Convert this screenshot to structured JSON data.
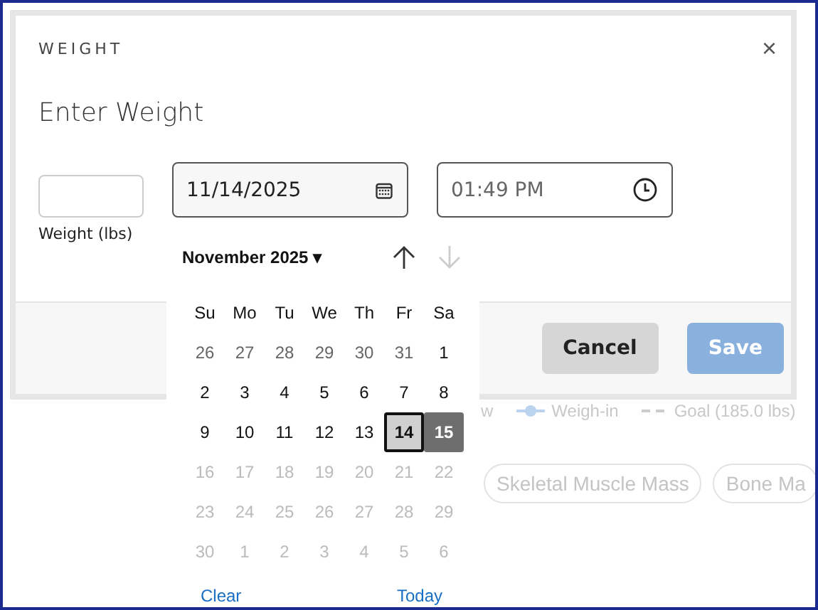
{
  "background": {
    "legend": [
      {
        "kind": "text",
        "label": "w"
      },
      {
        "kind": "line-dot",
        "label": "Weigh-in"
      },
      {
        "kind": "dashed",
        "label": "Goal (185.0 lbs)"
      }
    ],
    "chips": [
      "Skeletal Muscle Mass",
      "Bone Ma"
    ]
  },
  "dialog": {
    "title": "WEIGHT",
    "close": "×",
    "heading": "Enter Weight",
    "weight": {
      "label": "Weight (lbs)"
    },
    "date": {
      "value": "11/14/2025"
    },
    "time": {
      "value": "01:49 PM"
    },
    "buttons": [
      {
        "label": "Cancel",
        "kind": "secondary"
      },
      {
        "label": "Save",
        "kind": "primary",
        "disabled": true
      }
    ]
  },
  "calendar": {
    "month": "November 2025",
    "caret": "▾",
    "prev_disabled": false,
    "next_disabled": true,
    "weekdays": [
      "Su",
      "Mo",
      "Tu",
      "We",
      "Th",
      "Fr",
      "Sa"
    ],
    "weeks": [
      [
        {
          "day": "26",
          "kind": "adjacent",
          "selected": false,
          "focused": false
        },
        {
          "day": "27",
          "kind": "adjacent",
          "selected": false,
          "focused": false
        },
        {
          "day": "28",
          "kind": "adjacent",
          "selected": false,
          "focused": false
        },
        {
          "day": "29",
          "kind": "adjacent",
          "selected": false,
          "focused": false
        },
        {
          "day": "30",
          "kind": "adjacent",
          "selected": false,
          "focused": false
        },
        {
          "day": "31",
          "kind": "adjacent",
          "selected": false,
          "focused": false
        },
        {
          "day": "1",
          "kind": "enabled",
          "selected": false,
          "focused": false
        }
      ],
      [
        {
          "day": "2",
          "kind": "enabled",
          "selected": false,
          "focused": false
        },
        {
          "day": "3",
          "kind": "enabled",
          "selected": false,
          "focused": false
        },
        {
          "day": "4",
          "kind": "enabled",
          "selected": false,
          "focused": false
        },
        {
          "day": "5",
          "kind": "enabled",
          "selected": false,
          "focused": false
        },
        {
          "day": "6",
          "kind": "enabled",
          "selected": false,
          "focused": false
        },
        {
          "day": "7",
          "kind": "enabled",
          "selected": false,
          "focused": false
        },
        {
          "day": "8",
          "kind": "enabled",
          "selected": false,
          "focused": false
        }
      ],
      [
        {
          "day": "9",
          "kind": "enabled",
          "selected": false,
          "focused": false
        },
        {
          "day": "10",
          "kind": "enabled",
          "selected": false,
          "focused": false
        },
        {
          "day": "11",
          "kind": "enabled",
          "selected": false,
          "focused": false
        },
        {
          "day": "12",
          "kind": "enabled",
          "selected": false,
          "focused": false
        },
        {
          "day": "13",
          "kind": "enabled",
          "selected": false,
          "focused": false
        },
        {
          "day": "14",
          "kind": "enabled",
          "selected": true,
          "focused": false
        },
        {
          "day": "15",
          "kind": "enabled",
          "selected": false,
          "focused": true
        }
      ],
      [
        {
          "day": "16",
          "kind": "disabled",
          "selected": false,
          "focused": false
        },
        {
          "day": "17",
          "kind": "disabled",
          "selected": false,
          "focused": false
        },
        {
          "day": "18",
          "kind": "disabled",
          "selected": false,
          "focused": false
        },
        {
          "day": "19",
          "kind": "disabled",
          "selected": false,
          "focused": false
        },
        {
          "day": "20",
          "kind": "disabled",
          "selected": false,
          "focused": false
        },
        {
          "day": "21",
          "kind": "disabled",
          "selected": false,
          "focused": false
        },
        {
          "day": "22",
          "kind": "disabled",
          "selected": false,
          "focused": false
        }
      ],
      [
        {
          "day": "23",
          "kind": "disabled",
          "selected": false,
          "focused": false
        },
        {
          "day": "24",
          "kind": "disabled",
          "selected": false,
          "focused": false
        },
        {
          "day": "25",
          "kind": "disabled",
          "selected": false,
          "focused": false
        },
        {
          "day": "26",
          "kind": "disabled",
          "selected": false,
          "focused": false
        },
        {
          "day": "27",
          "kind": "disabled",
          "selected": false,
          "focused": false
        },
        {
          "day": "28",
          "kind": "disabled",
          "selected": false,
          "focused": false
        },
        {
          "day": "29",
          "kind": "disabled",
          "selected": false,
          "focused": false
        }
      ],
      [
        {
          "day": "30",
          "kind": "disabled",
          "selected": false,
          "focused": false
        },
        {
          "day": "1",
          "kind": "disabled",
          "selected": false,
          "focused": false
        },
        {
          "day": "2",
          "kind": "disabled",
          "selected": false,
          "focused": false
        },
        {
          "day": "3",
          "kind": "disabled",
          "selected": false,
          "focused": false
        },
        {
          "day": "4",
          "kind": "disabled",
          "selected": false,
          "focused": false
        },
        {
          "day": "5",
          "kind": "disabled",
          "selected": false,
          "focused": false
        },
        {
          "day": "6",
          "kind": "disabled",
          "selected": false,
          "focused": false
        }
      ]
    ],
    "footer": [
      "Clear",
      "Today"
    ]
  }
}
